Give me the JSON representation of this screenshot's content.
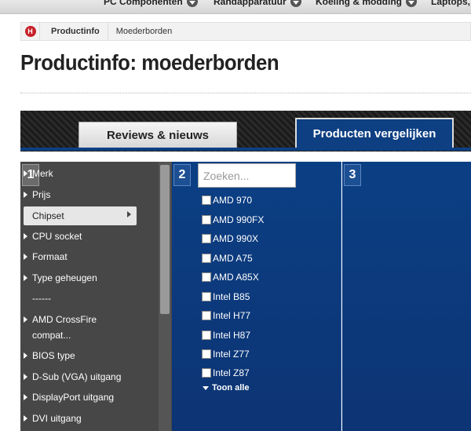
{
  "topnav": {
    "items": [
      {
        "label": "PC Componenten"
      },
      {
        "label": "Randapparatuur"
      },
      {
        "label": "Koeling & modding"
      },
      {
        "label": "Laptops,"
      }
    ]
  },
  "breadcrumb": {
    "home_icon": "hardware-info-logo",
    "home_letter": "H",
    "section": "Productinfo",
    "current": "Moederborden"
  },
  "page": {
    "title": "Productinfo: moederborden"
  },
  "tabs": {
    "reviews": "Reviews & nieuws",
    "compare": "Producten vergelijken"
  },
  "column1": {
    "number": "1",
    "items": [
      {
        "label": "Merk"
      },
      {
        "label": "Prijs"
      },
      {
        "label": "Chipset"
      },
      {
        "label": "CPU socket"
      },
      {
        "label": "Formaat"
      },
      {
        "label": "Type geheugen"
      },
      {
        "label": "------"
      },
      {
        "label": "AMD CrossFire compat..."
      },
      {
        "label": "BIOS type"
      },
      {
        "label": "D-Sub (VGA) uitgang"
      },
      {
        "label": "DisplayPort uitgang"
      },
      {
        "label": "DVI uitgang"
      }
    ],
    "active_item": "Chipset"
  },
  "column2": {
    "number": "2",
    "search_placeholder": "Zoeken...",
    "options": [
      {
        "label": "AMD 970"
      },
      {
        "label": "AMD 990FX"
      },
      {
        "label": "AMD 990X"
      },
      {
        "label": "AMD A75"
      },
      {
        "label": "AMD A85X"
      },
      {
        "label": "Intel B85"
      },
      {
        "label": "Intel H77"
      },
      {
        "label": "Intel H87"
      },
      {
        "label": "Intel Z77"
      },
      {
        "label": "Intel Z87"
      }
    ],
    "show_all": "Toon alle"
  },
  "column3": {
    "number": "3"
  },
  "colors": {
    "accent_blue": "#0d3f82",
    "brand_red": "#c8202a",
    "menu_bg": "#474747"
  }
}
